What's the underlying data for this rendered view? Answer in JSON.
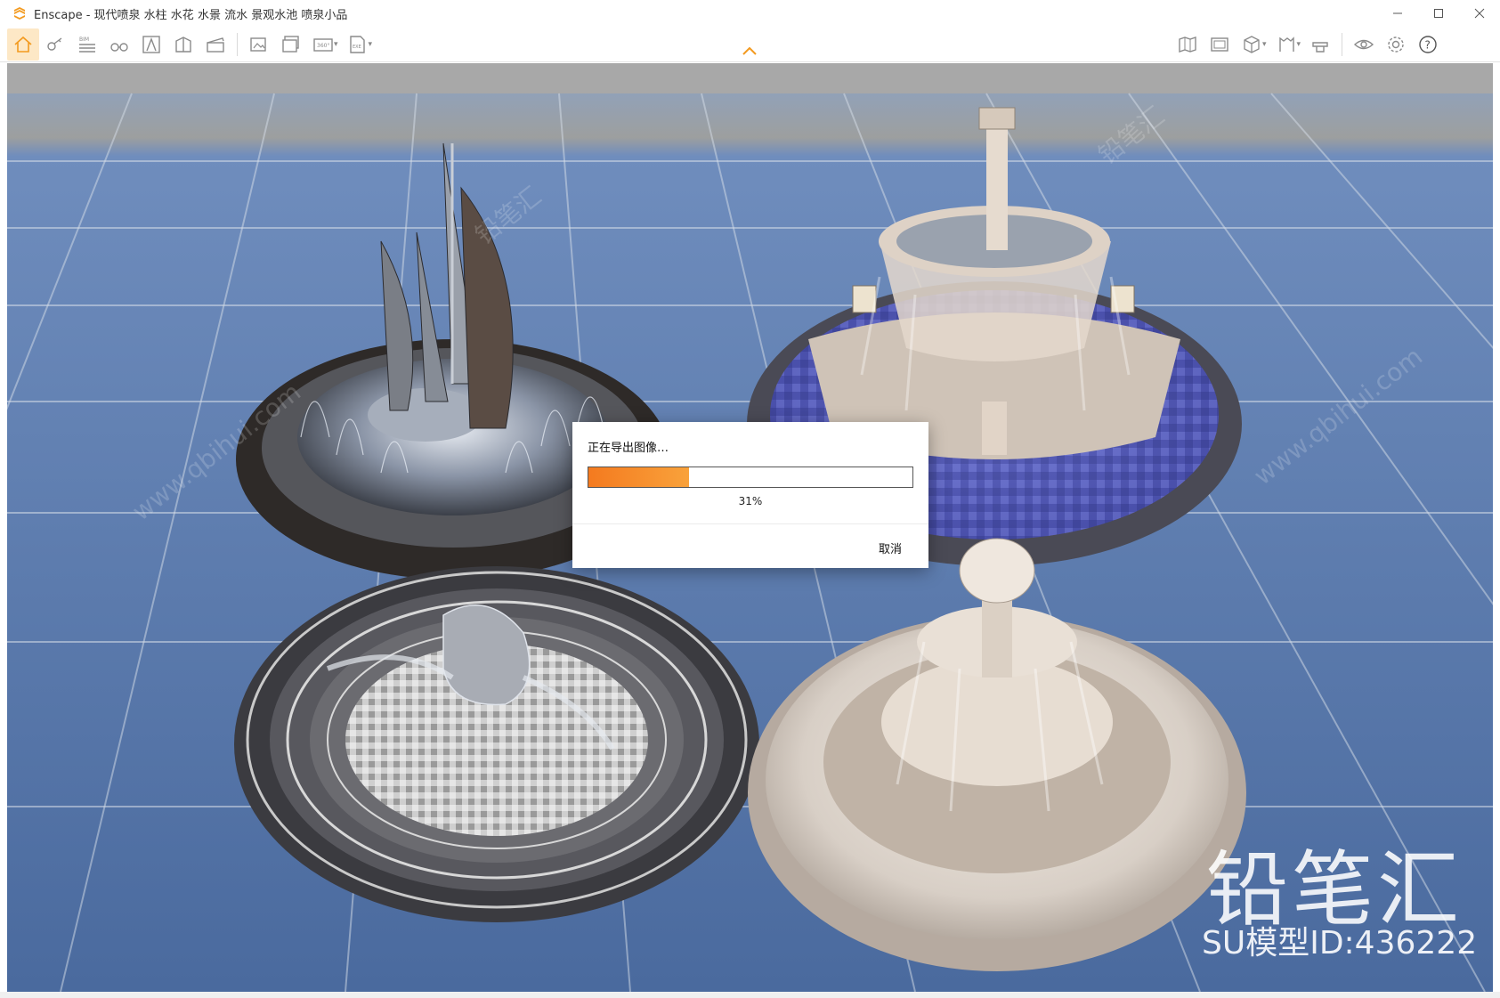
{
  "window": {
    "title": "Enscape - 现代喷泉 水柱 水花 水景 流水 景观水池 喷泉小品",
    "accent_color": "#f39a1f"
  },
  "titlebar": {
    "minimize_icon": "minimize-icon",
    "maximize_icon": "maximize-icon",
    "close_icon": "close-icon"
  },
  "toolbar": {
    "left_icons": [
      "home-icon",
      "key-icon",
      "bim-icon",
      "binoculars-icon",
      "view-icon",
      "assets-icon",
      "movie-clapper-icon",
      "screenshot-icon",
      "batch-render-icon",
      "panorama-360-icon",
      "export-icon"
    ],
    "right_icons": [
      "map-icon",
      "gallery-icon",
      "cube-icon",
      "bookmarks-icon",
      "hat-icon",
      "eye-icon",
      "settings-icon",
      "help-icon"
    ],
    "bim_label": "BIM",
    "pano_label": "360°",
    "exe_label": "EXE"
  },
  "modal": {
    "title": "正在导出图像…",
    "progress_percent": 31,
    "progress_label": "31%",
    "cancel_label": "取消"
  },
  "watermark": {
    "brand": "铅笔汇",
    "model_id": "SU模型ID:436222",
    "site": "www.qbihui.com"
  }
}
